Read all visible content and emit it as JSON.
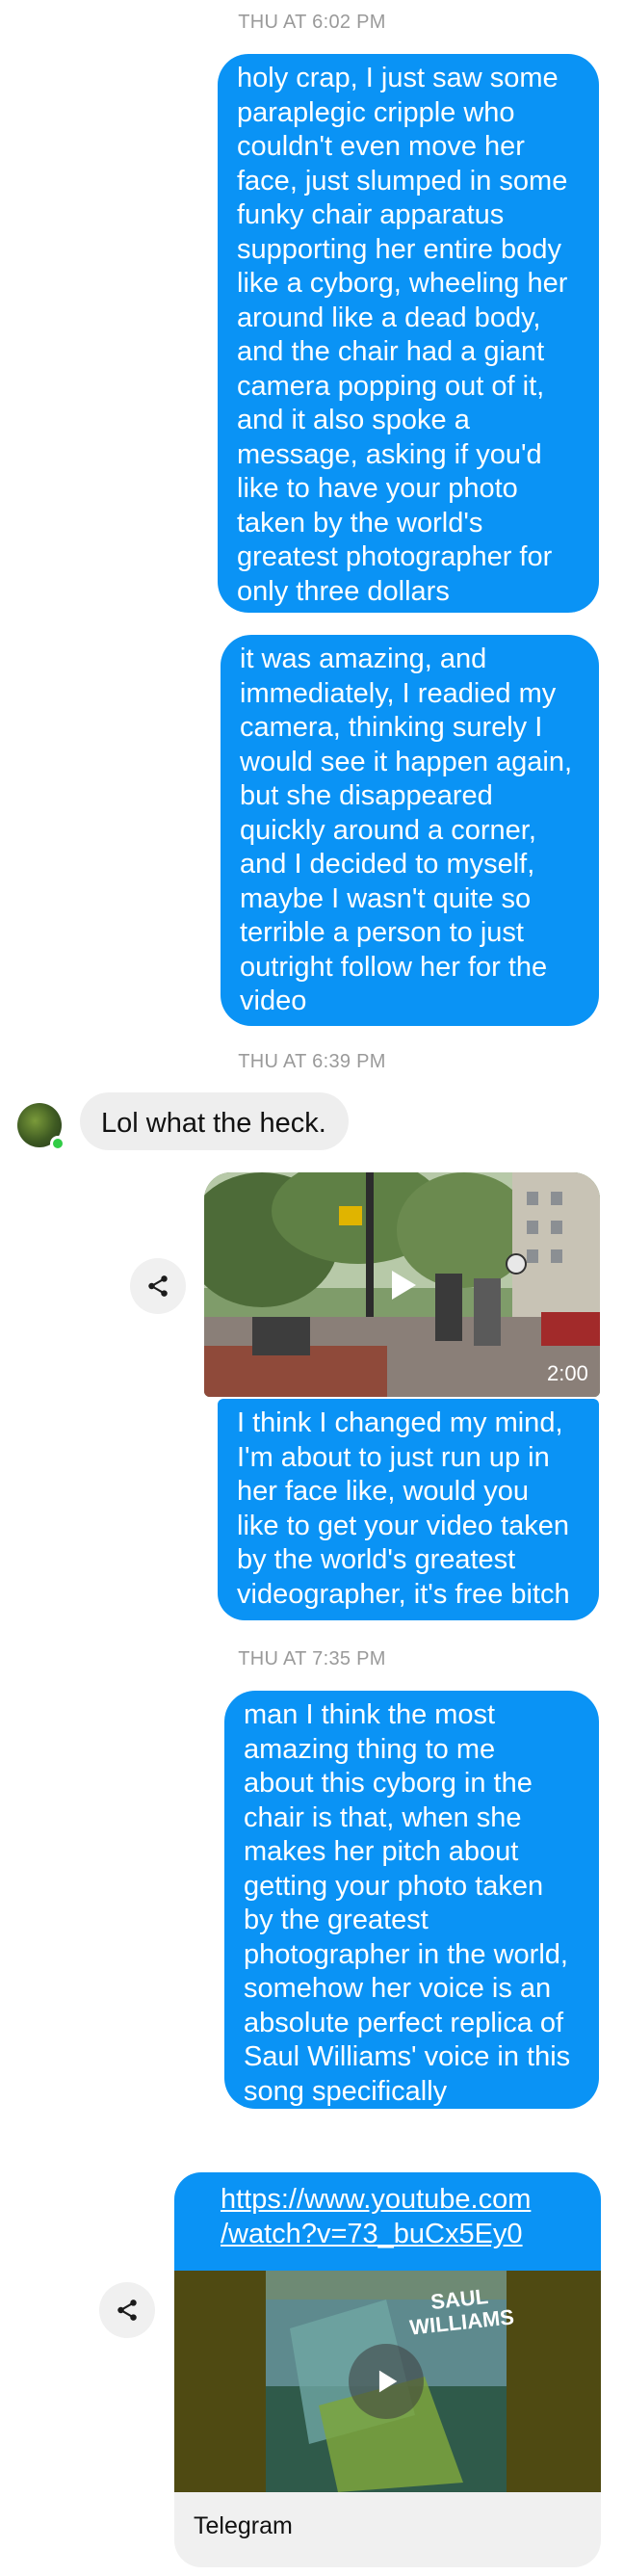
{
  "thread": {
    "timestamps": [
      "THU AT 6:02 PM",
      "THU AT 6:39 PM",
      "THU AT 7:35 PM"
    ],
    "messages": {
      "m1": "holy crap, I just saw some\nparaplegic cripple who\ncouldn't even move her\nface, just slumped in some\nfunky chair apparatus\nsupporting her entire body\nlike a cyborg, wheeling her\naround like a dead body,\nand the chair had a giant\ncamera popping out of it,\nand it also spoke a\nmessage, asking if you'd\nlike to have your photo\ntaken by the world's\ngreatest photographer for\nonly three dollars",
      "m2": "it was amazing, and\nimmediately, I readied my\ncamera, thinking surely I\nwould see it happen again,\nbut she disappeared\nquickly around a corner,\nand I decided to myself,\nmaybe I wasn't quite so\nterrible a person to just\noutright follow her for the\nvideo",
      "m3": "Lol what the heck.",
      "m4": "I think I changed my mind,\nI'm about to just run up in\nher face like, would you\nlike to get your video taken\nby the world's greatest\nvideographer, it's free bitch",
      "m5": "man I think the most\namazing thing to me\nabout this cyborg in the\nchair is that, when she\nmakes her pitch about\ngetting your photo taken\nby the greatest\nphotographer in the world,\nsomehow her voice is an\nabsolute perfect replica of\nSaul Williams' voice in this\nsong specifically"
    },
    "video": {
      "duration": "2:00"
    },
    "link": {
      "url": "https://www.youtube.com\n/watch?v=73_buCx5Ey0",
      "album_text": "SAUL\nWILLIAMS",
      "source": "Telegram"
    }
  },
  "colors": {
    "outgoing": "#0a93f5",
    "incoming": "#eeeeee",
    "online": "#31cc46"
  },
  "icons": {
    "share": "share-icon",
    "play": "play-icon"
  }
}
